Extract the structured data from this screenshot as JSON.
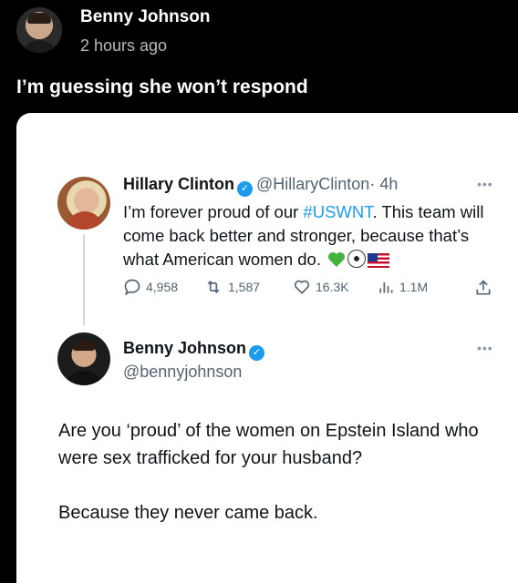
{
  "post": {
    "author": "Benny Johnson",
    "time": "2 hours ago",
    "caption": "I’m guessing she won’t respond"
  },
  "quoted_tweet": {
    "name": "Hillary Clinton",
    "handle": "@HillaryClinton",
    "time": "· 4h",
    "text_before": "I’m forever proud of our ",
    "hashtag": "#USWNT",
    "text_after": ". This team will come back better and stronger, because that’s what American women do.",
    "emojis": [
      "green-heart-icon",
      "soccer-ball-icon",
      "us-flag-icon"
    ],
    "stats": {
      "replies": "4,958",
      "retweets": "1,587",
      "likes": "16.3K",
      "views": "1.1M"
    }
  },
  "reply_tweet": {
    "name": "Benny Johnson",
    "handle": "@bennyjohnson",
    "paragraphs": [
      "Are you ‘proud’ of the women on Epstein Island who were sex trafficked for your husband?",
      "Because they never came back."
    ]
  },
  "colors": {
    "background": "#000000",
    "card": "#ffffff",
    "verified": "#1d9bf0",
    "hashtag": "#1d9bf0",
    "muted": "#536471"
  }
}
